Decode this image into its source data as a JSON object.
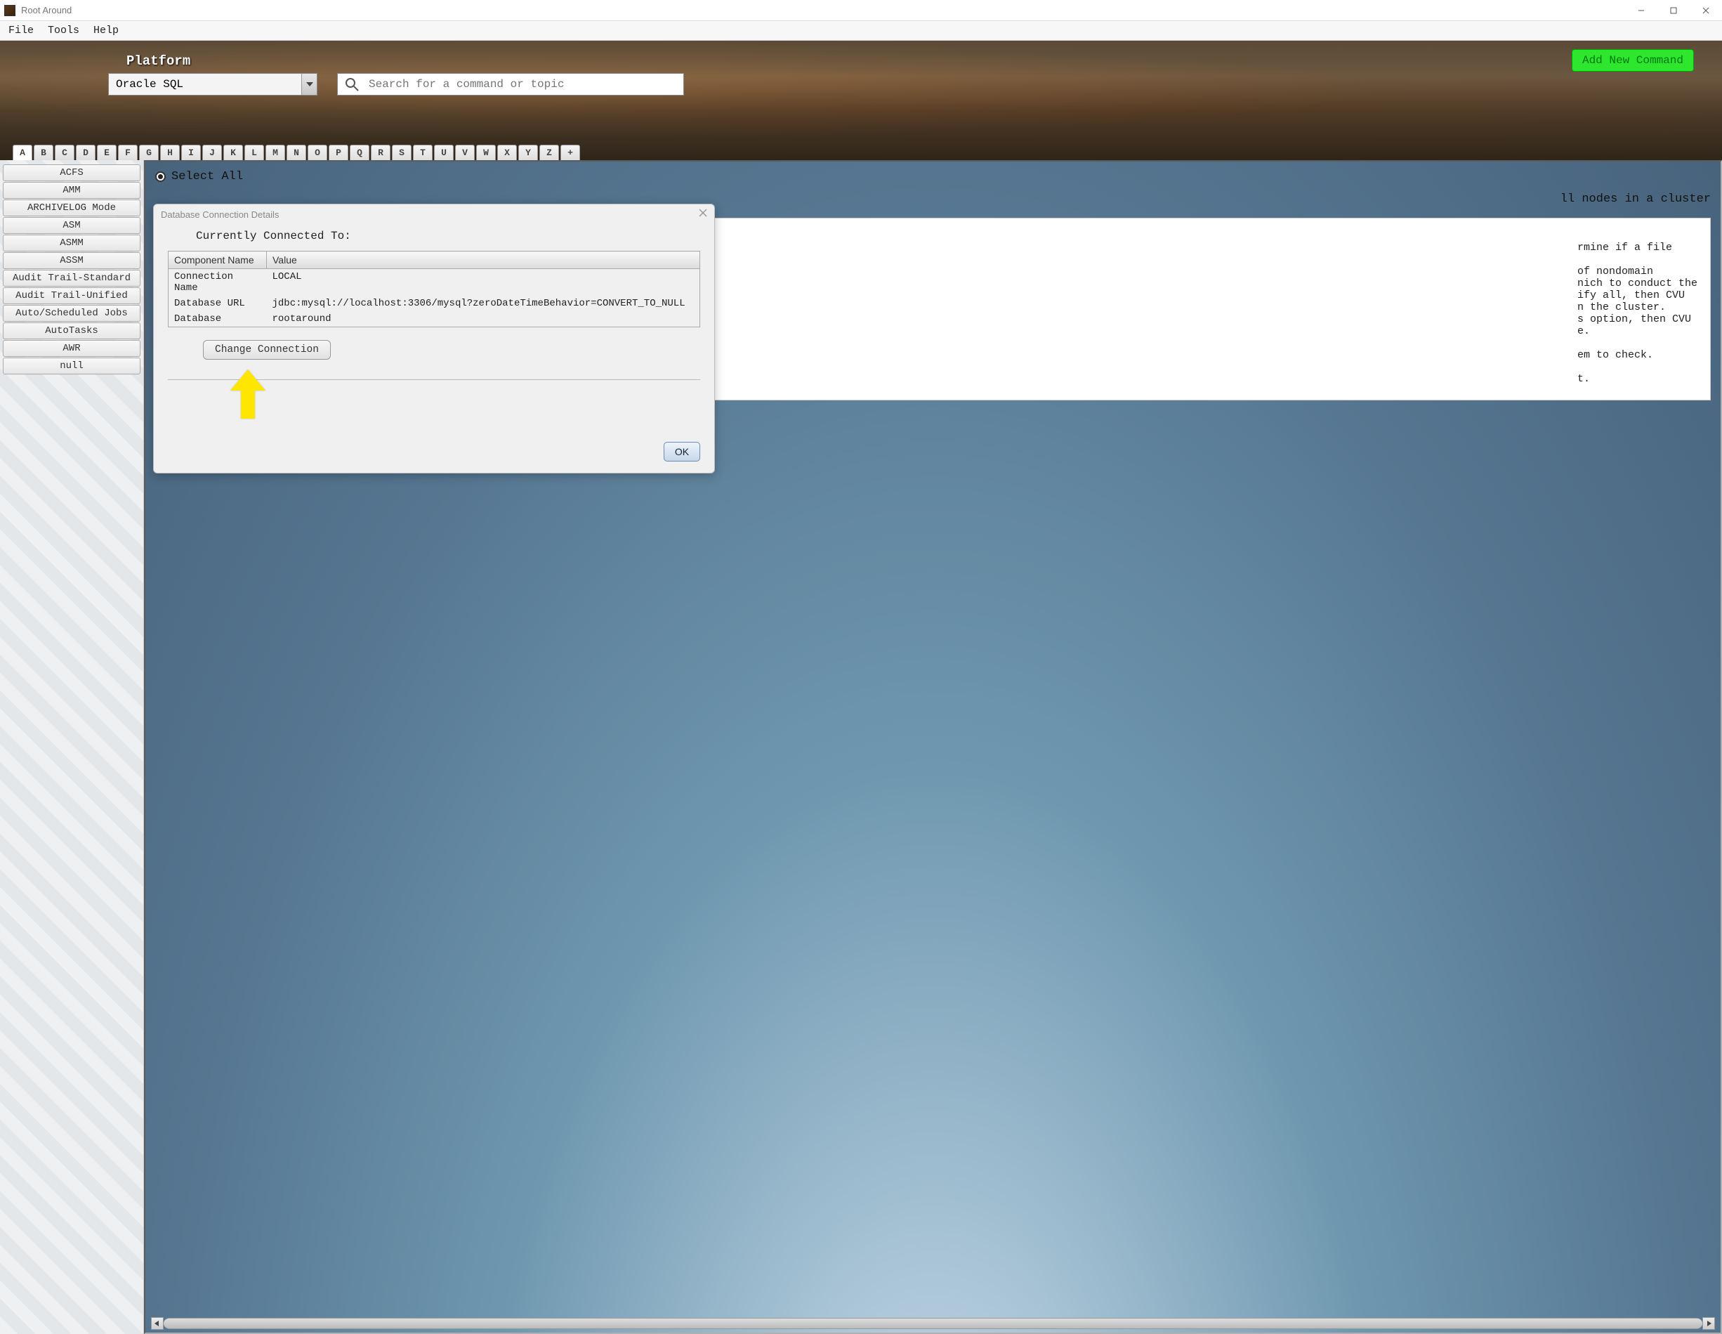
{
  "window": {
    "title": "Root Around"
  },
  "menu": {
    "items": [
      "File",
      "Tools",
      "Help"
    ]
  },
  "banner": {
    "platform_label": "Platform",
    "platform_value": "Oracle SQL",
    "search_placeholder": "Search for a command or topic",
    "add_command": "Add New Command"
  },
  "alpha": {
    "letters": [
      "A",
      "B",
      "C",
      "D",
      "E",
      "F",
      "G",
      "H",
      "I",
      "J",
      "K",
      "L",
      "M",
      "N",
      "O",
      "P",
      "Q",
      "R",
      "S",
      "T",
      "U",
      "V",
      "W",
      "X",
      "Y",
      "Z",
      "+"
    ],
    "active": "A"
  },
  "sidebar": {
    "items": [
      "ACFS",
      "AMM",
      "ARCHIVELOG Mode",
      "ASM",
      "ASMM",
      "ASSM",
      "Audit Trail-Standard",
      "Audit Trail-Unified",
      "Auto/Scheduled Jobs",
      "AutoTasks",
      "AWR",
      "null"
    ]
  },
  "content": {
    "select_all": "Select All",
    "cluster_line": "ll nodes in a cluster",
    "doc_text": "rmine if a file\n\nof nondomain\nnich to conduct the\nify all, then CVU\nn the cluster.\ns option, then CVU\ne.\n\nem to check.\n\nt."
  },
  "modal": {
    "title": "Database Connection Details",
    "subtitle": "Currently Connected To:",
    "columns": {
      "name": "Component Name",
      "value": "Value"
    },
    "rows": [
      {
        "name": "Connection Name",
        "value": "LOCAL"
      },
      {
        "name": "Database URL",
        "value": "jdbc:mysql://localhost:3306/mysql?zeroDateTimeBehavior=CONVERT_TO_NULL"
      },
      {
        "name": "Database",
        "value": "rootaround"
      }
    ],
    "change_btn": "Change Connection",
    "ok_btn": "OK"
  }
}
